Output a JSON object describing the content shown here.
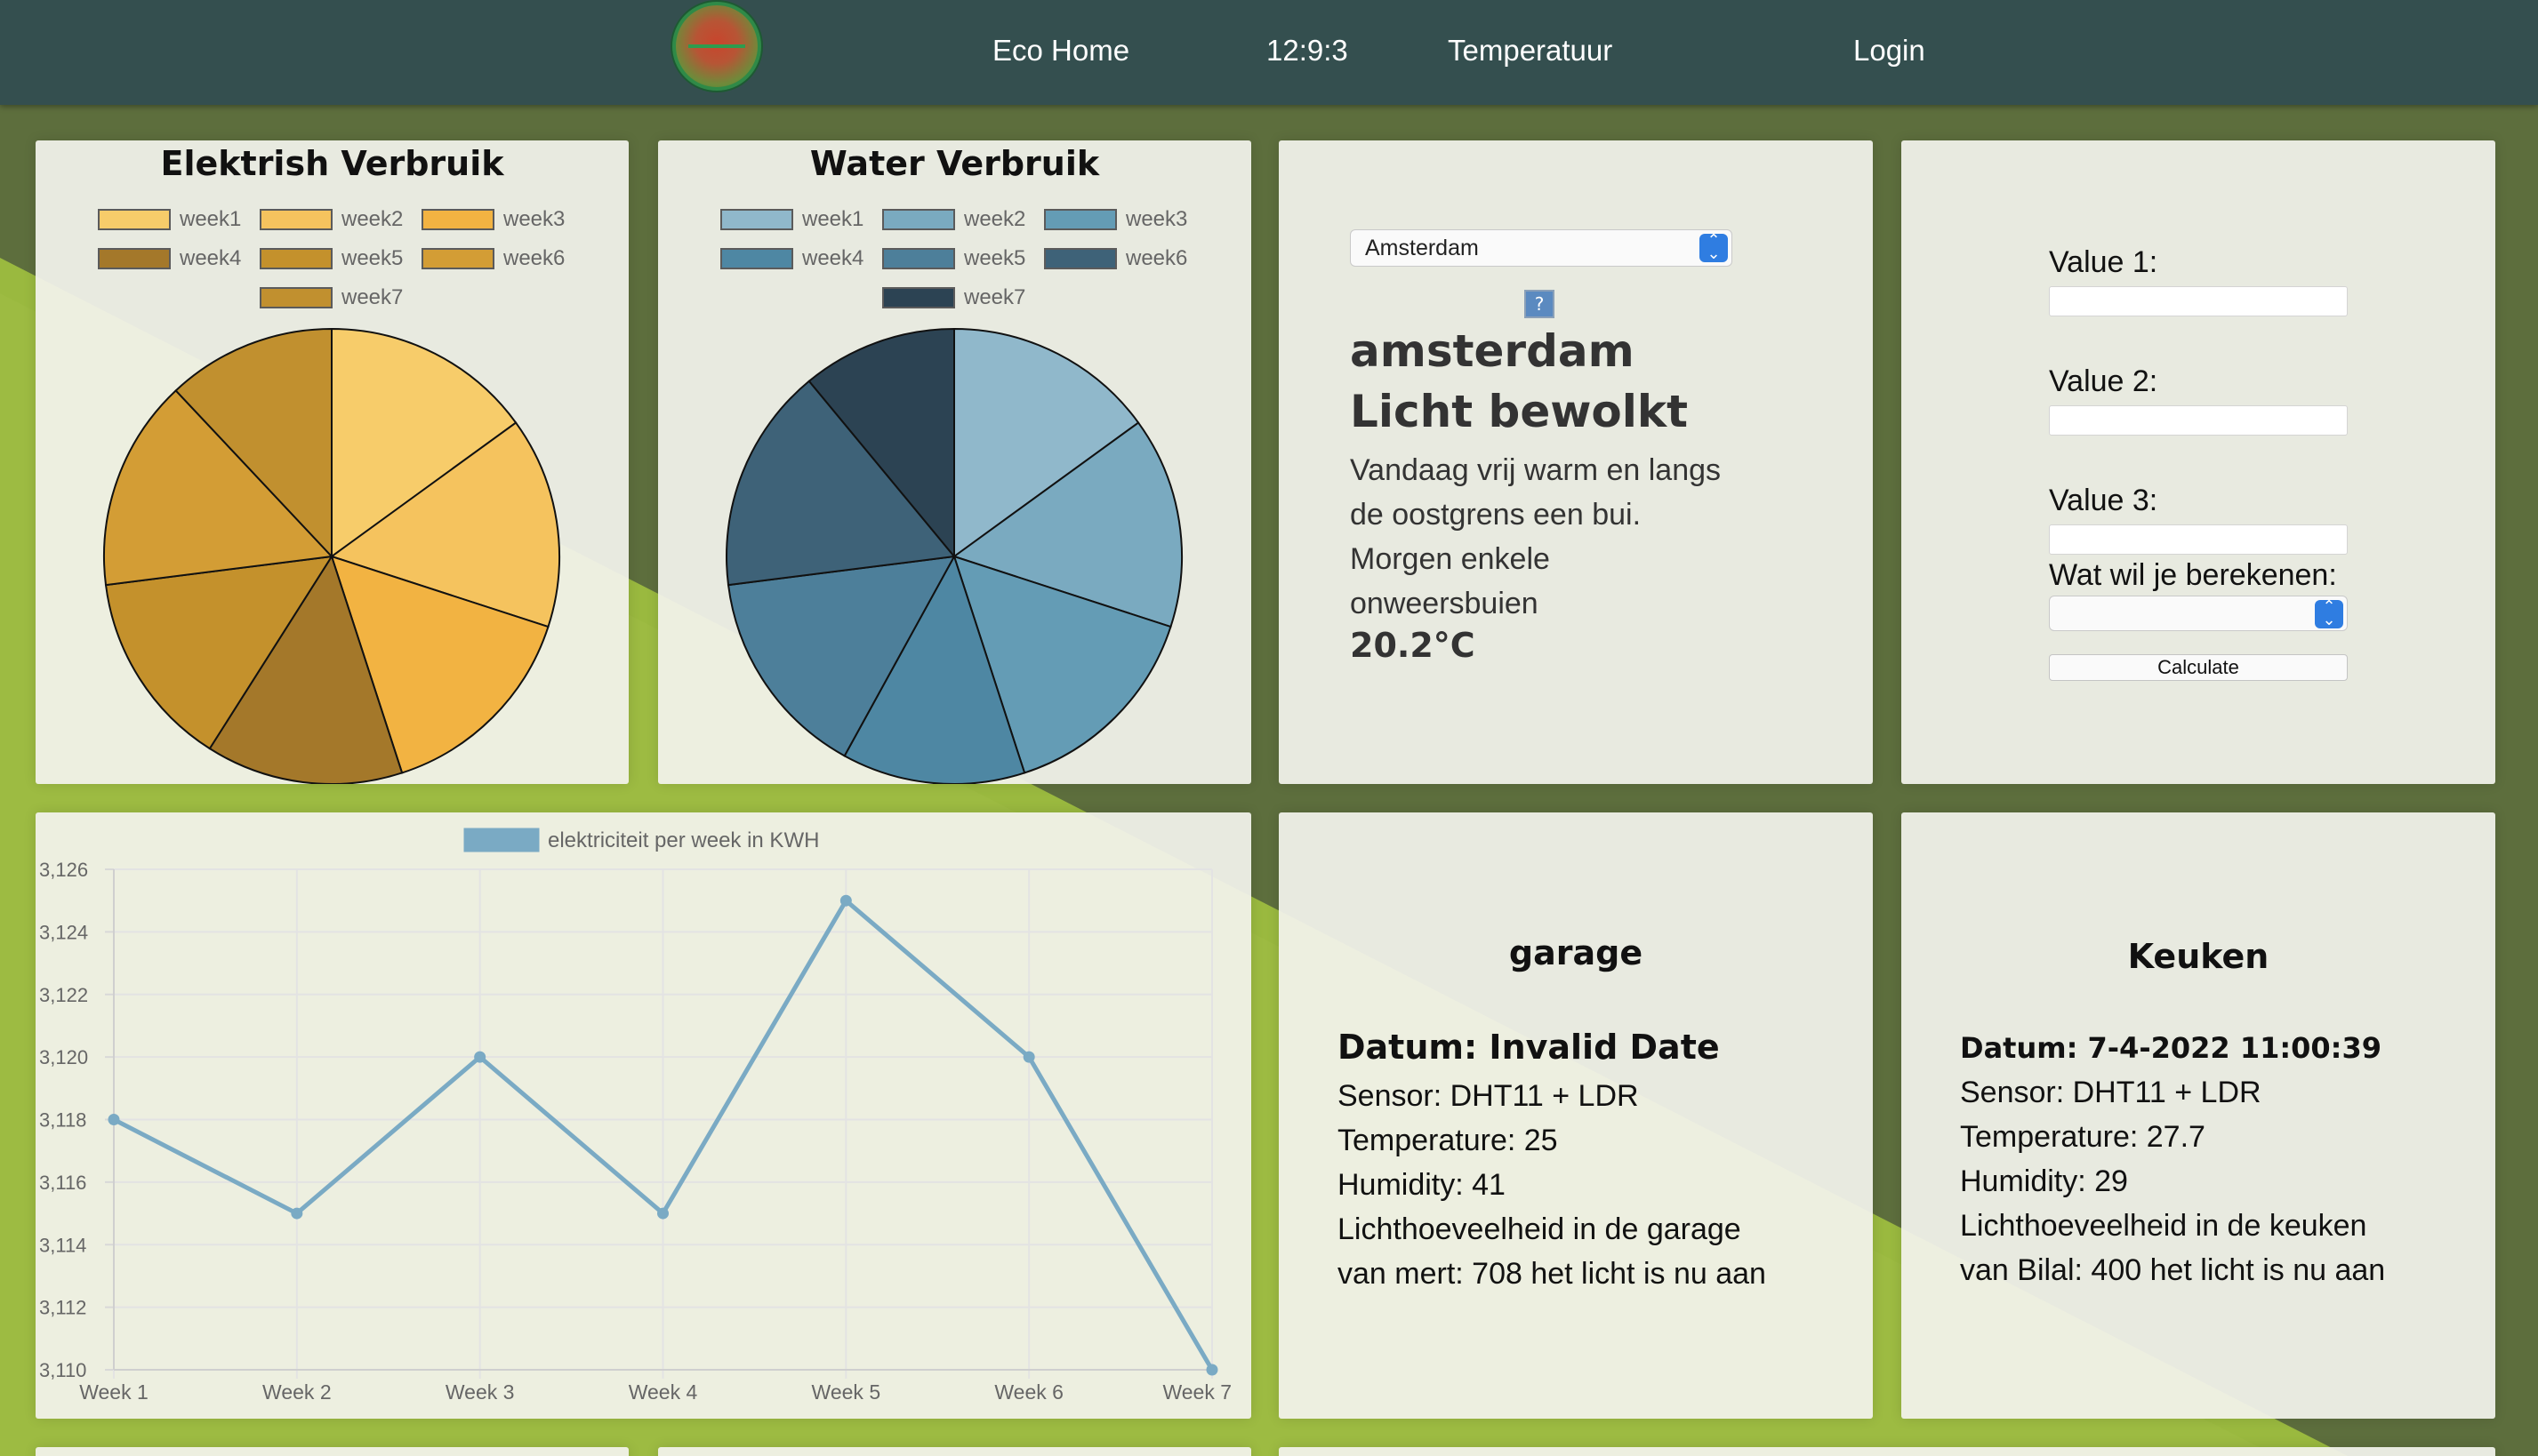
{
  "navbar": {
    "home": "Eco Home",
    "clock": "12:9:3",
    "temperature": "Temperatuur",
    "login": "Login"
  },
  "electric_card": {
    "title": "Elektrish Verbruik"
  },
  "water_card": {
    "title": "Water Verbruik"
  },
  "weather": {
    "city_select": "Amsterdam",
    "icon_fallback": "?",
    "city": "amsterdam",
    "status": "Licht bewolkt",
    "description": "Vandaag vrij warm en langs de oostgrens een bui. Morgen enkele onweersbuien",
    "temperature": "20.2°C"
  },
  "calculator": {
    "value1_label": "Value 1:",
    "value2_label": "Value 2:",
    "value3_label": "Value 3:",
    "operation_label": "Wat wil je berekenen:",
    "button_label": "Calculate"
  },
  "garage": {
    "title": "garage",
    "date": "Datum: Invalid Date",
    "sensor": "Sensor: DHT11 + LDR",
    "temperature": "Temperature: 25",
    "humidity": "Humidity: 41",
    "light_line1": "Lichthoeveelheid in de garage",
    "light_line2": "van mert: 708 het licht is nu aan"
  },
  "keuken": {
    "title": "Keuken",
    "date": "Datum: 7-4-2022 11:00:39",
    "sensor": "Sensor: DHT11 + LDR",
    "temperature": "Temperature: 27.7",
    "humidity": "Humidity: 29",
    "light_line1": "Lichthoeveelheid in de keuken",
    "light_line2": "van Bilal: 400 het licht is nu aan"
  },
  "colors": {
    "navbar": "#344f4f",
    "background_dark": "#5d6e3d",
    "background_green": "#9ab93f",
    "line_series": "#7aaac4"
  },
  "chart_data": [
    {
      "type": "pie",
      "title": "Elektrish Verbruik",
      "categories": [
        "week1",
        "week2",
        "week3",
        "week4",
        "week5",
        "week6",
        "week7"
      ],
      "values": [
        15,
        15,
        15,
        14,
        14,
        15,
        12
      ],
      "colors": [
        "#f7cc6a",
        "#f5c35e",
        "#f2b342",
        "#a4782a",
        "#c4912c",
        "#d39d35",
        "#c1902f"
      ],
      "legend": "top"
    },
    {
      "type": "pie",
      "title": "Water Verbruik",
      "categories": [
        "week1",
        "week2",
        "week3",
        "week4",
        "week5",
        "week6",
        "week7"
      ],
      "values": [
        15,
        15,
        15,
        13,
        15,
        16,
        11
      ],
      "colors": [
        "#90b8cb",
        "#7aaac0",
        "#649cb5",
        "#4e87a3",
        "#4d7f9a",
        "#3e6278",
        "#2c4353"
      ],
      "legend": "top"
    },
    {
      "type": "line",
      "series": [
        {
          "name": "elektriciteit per week in KWH",
          "values": [
            3118,
            3115,
            3120,
            3115,
            3125,
            3120,
            3110
          ]
        }
      ],
      "categories": [
        "Week 1",
        "Week 2",
        "Week 3",
        "Week 4",
        "Week 5",
        "Week 6",
        "Week 7"
      ],
      "ylim": [
        3110,
        3126
      ],
      "yticks": [
        "3,110",
        "3,112",
        "3,114",
        "3,116",
        "3,118",
        "3,120",
        "3,122",
        "3,124",
        "3,126"
      ],
      "grid": true,
      "legend": "top"
    }
  ]
}
